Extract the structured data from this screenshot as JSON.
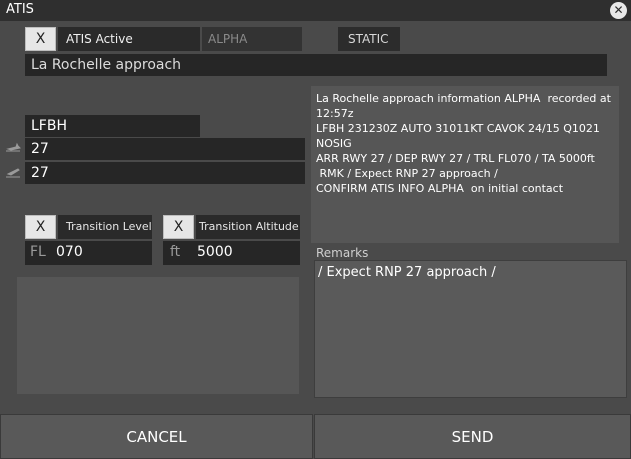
{
  "window": {
    "title": "ATIS"
  },
  "atis_active": {
    "checkbox_mark": "X",
    "label": "ATIS Active"
  },
  "letter": "ALPHA",
  "mode": "STATIC",
  "station_name": "La Rochelle approach",
  "airport": {
    "icao": "LFBH",
    "arrival_runway": "27",
    "departure_runway": "27"
  },
  "transition_level": {
    "checkbox_mark": "X",
    "label": "Transition Level",
    "unit": "FL",
    "value": "070"
  },
  "transition_altitude": {
    "checkbox_mark": "X",
    "label": "Transition Altitude",
    "unit": "ft",
    "value": "5000"
  },
  "atis_text": "La Rochelle approach information ALPHA  recorded at 12:57z\nLFBH 231230Z AUTO 31011KT CAVOK 24/15 Q1021 NOSIG\nARR RWY 27 / DEP RWY 27 / TRL FL070 / TA 5000ft\n RMK / Expect RNP 27 approach /\nCONFIRM ATIS INFO ALPHA  on initial contact",
  "remarks": {
    "label": "Remarks",
    "value": "/ Expect RNP 27 approach /"
  },
  "buttons": {
    "cancel": "CANCEL",
    "send": "SEND"
  }
}
